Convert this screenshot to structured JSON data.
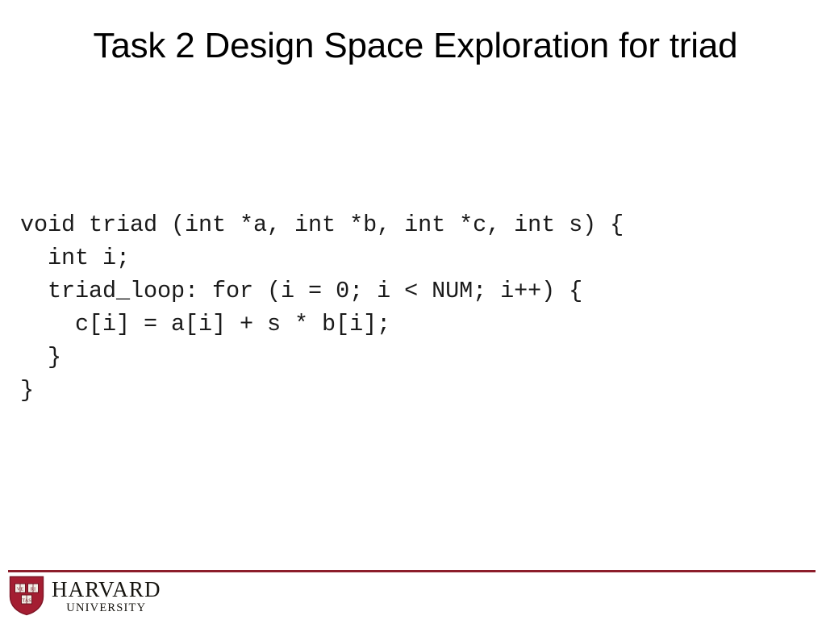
{
  "slide": {
    "background_color": "#ffffff",
    "title": "Task 2 Design Space Exploration for triad"
  },
  "code": {
    "language": "c",
    "lines": [
      "void triad (int *a, int *b, int *c, int s) {",
      "  int i;",
      "  triad_loop: for (i = 0; i < NUM; i++) {",
      "    c[i] = a[i] + s * b[i];",
      "  }",
      "}"
    ],
    "text_color": "#1a1a1a"
  },
  "footer": {
    "rule_color": "#8c1d2a",
    "logo": {
      "shield_color": "#a41e32",
      "shield_icon": "harvard-shield-icon",
      "book_labels": [
        "VE",
        "RI",
        "TAS"
      ],
      "wordmark": "HARVARD",
      "wordmark_sub": "UNIVERSITY"
    }
  }
}
